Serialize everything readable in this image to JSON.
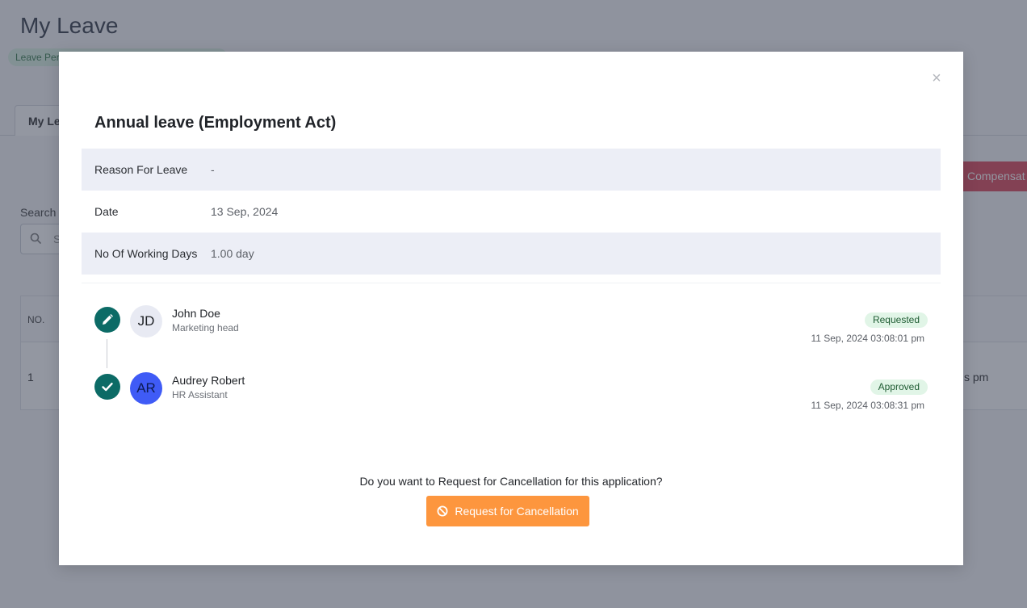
{
  "background": {
    "page_title": "My Leave",
    "policy_pill": "Leave Per",
    "active_tab": "My Le",
    "compensation_button": "Compensat",
    "search_label": "Search",
    "search_placeholder": "S",
    "table": {
      "col_no": "NO.",
      "row_no": "1",
      "row_time_partial": "s pm"
    }
  },
  "modal": {
    "close_glyph": "×",
    "title": "Annual leave (Employment Act)",
    "details": [
      {
        "label": "Reason For Leave",
        "value": "-"
      },
      {
        "label": "Date",
        "value": "13 Sep, 2024"
      },
      {
        "label": "No Of Working Days",
        "value": "1.00 day"
      }
    ],
    "timeline": [
      {
        "icon": "pencil-icon",
        "initials": "JD",
        "name": "John Doe",
        "role": "Marketing head",
        "status": "Requested",
        "timestamp": "11 Sep, 2024 03:08:01 pm",
        "avatar_bg": "#e8eaf3",
        "avatar_fg": "#1f2226"
      },
      {
        "icon": "check-icon",
        "initials": "AR",
        "name": "Audrey Robert",
        "role": "HR Assistant",
        "status": "Approved",
        "timestamp": "11 Sep, 2024 03:08:31 pm",
        "avatar_bg": "#3f5bf6",
        "avatar_fg": "#0c1a52"
      }
    ],
    "cancel_prompt": "Do you want to Request for Cancellation for this application?",
    "cancel_button": "Request for Cancellation"
  },
  "colors": {
    "status_circle": "#0c6b66",
    "badge_bg": "#e1f5e7",
    "cancel_button": "#fd963e",
    "row_shade": "#eceef6"
  }
}
